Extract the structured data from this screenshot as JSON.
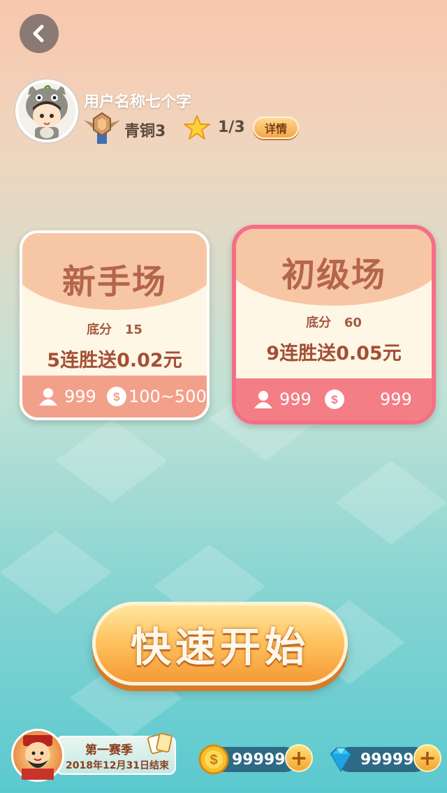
{
  "profile": {
    "username": "用户名称七个字",
    "rank": "青铜3",
    "star_progress": "1/3",
    "details_label": "详情"
  },
  "rooms": [
    {
      "title": "新手场",
      "base_label": "底分",
      "base_value": "15",
      "reward": "5连胜送0.02元",
      "players": "999",
      "coin_range": "100~500"
    },
    {
      "title": "初级场",
      "base_label": "底分",
      "base_value": "60",
      "reward": "9连胜送0.05元",
      "players": "999",
      "coin_range": "999"
    }
  ],
  "quick_start": "快速开始",
  "season": {
    "title": "第一赛季",
    "end": "2018年12月31日结束"
  },
  "currency": {
    "gold": "99999",
    "diamond": "99999"
  },
  "icons": {
    "back": "back-arrow-icon",
    "rank": "bronze-rank-badge-icon",
    "star": "star-icon",
    "player": "player-icon",
    "coin": "coin-icon",
    "diamond": "diamond-icon",
    "plus": "plus-icon"
  },
  "colors": {
    "accent_pink": "#f66e86",
    "room_header": "#f7c7a5",
    "button_orange": "#f59a35"
  }
}
